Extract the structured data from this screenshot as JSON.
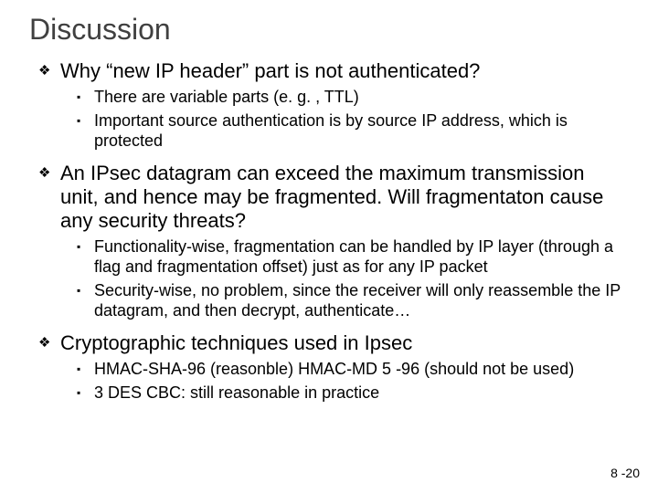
{
  "title": "Discussion",
  "items": [
    {
      "text": "Why “new IP header” part is not authenticated?",
      "sub": [
        "There are variable parts (e. g. , TTL)",
        "Important source authentication is by source IP address, which is protected"
      ]
    },
    {
      "text": "An IPsec datagram can exceed the maximum transmission unit, and hence may be fragmented. Will fragmentaton cause any security threats?",
      "sub": [
        "Functionality-wise, fragmentation can be handled by IP layer (through a flag and fragmentation offset) just as for any IP packet",
        "Security-wise, no problem, since the receiver will only reassemble the IP datagram, and then decrypt, authenticate…"
      ]
    },
    {
      "text": "Cryptographic techniques used in Ipsec",
      "sub": [
        "HMAC-SHA-96 (reasonble) HMAC-MD 5 -96 (should not be used)",
        "3 DES CBC: still reasonable in practice"
      ]
    }
  ],
  "pagenum": "8 -20"
}
